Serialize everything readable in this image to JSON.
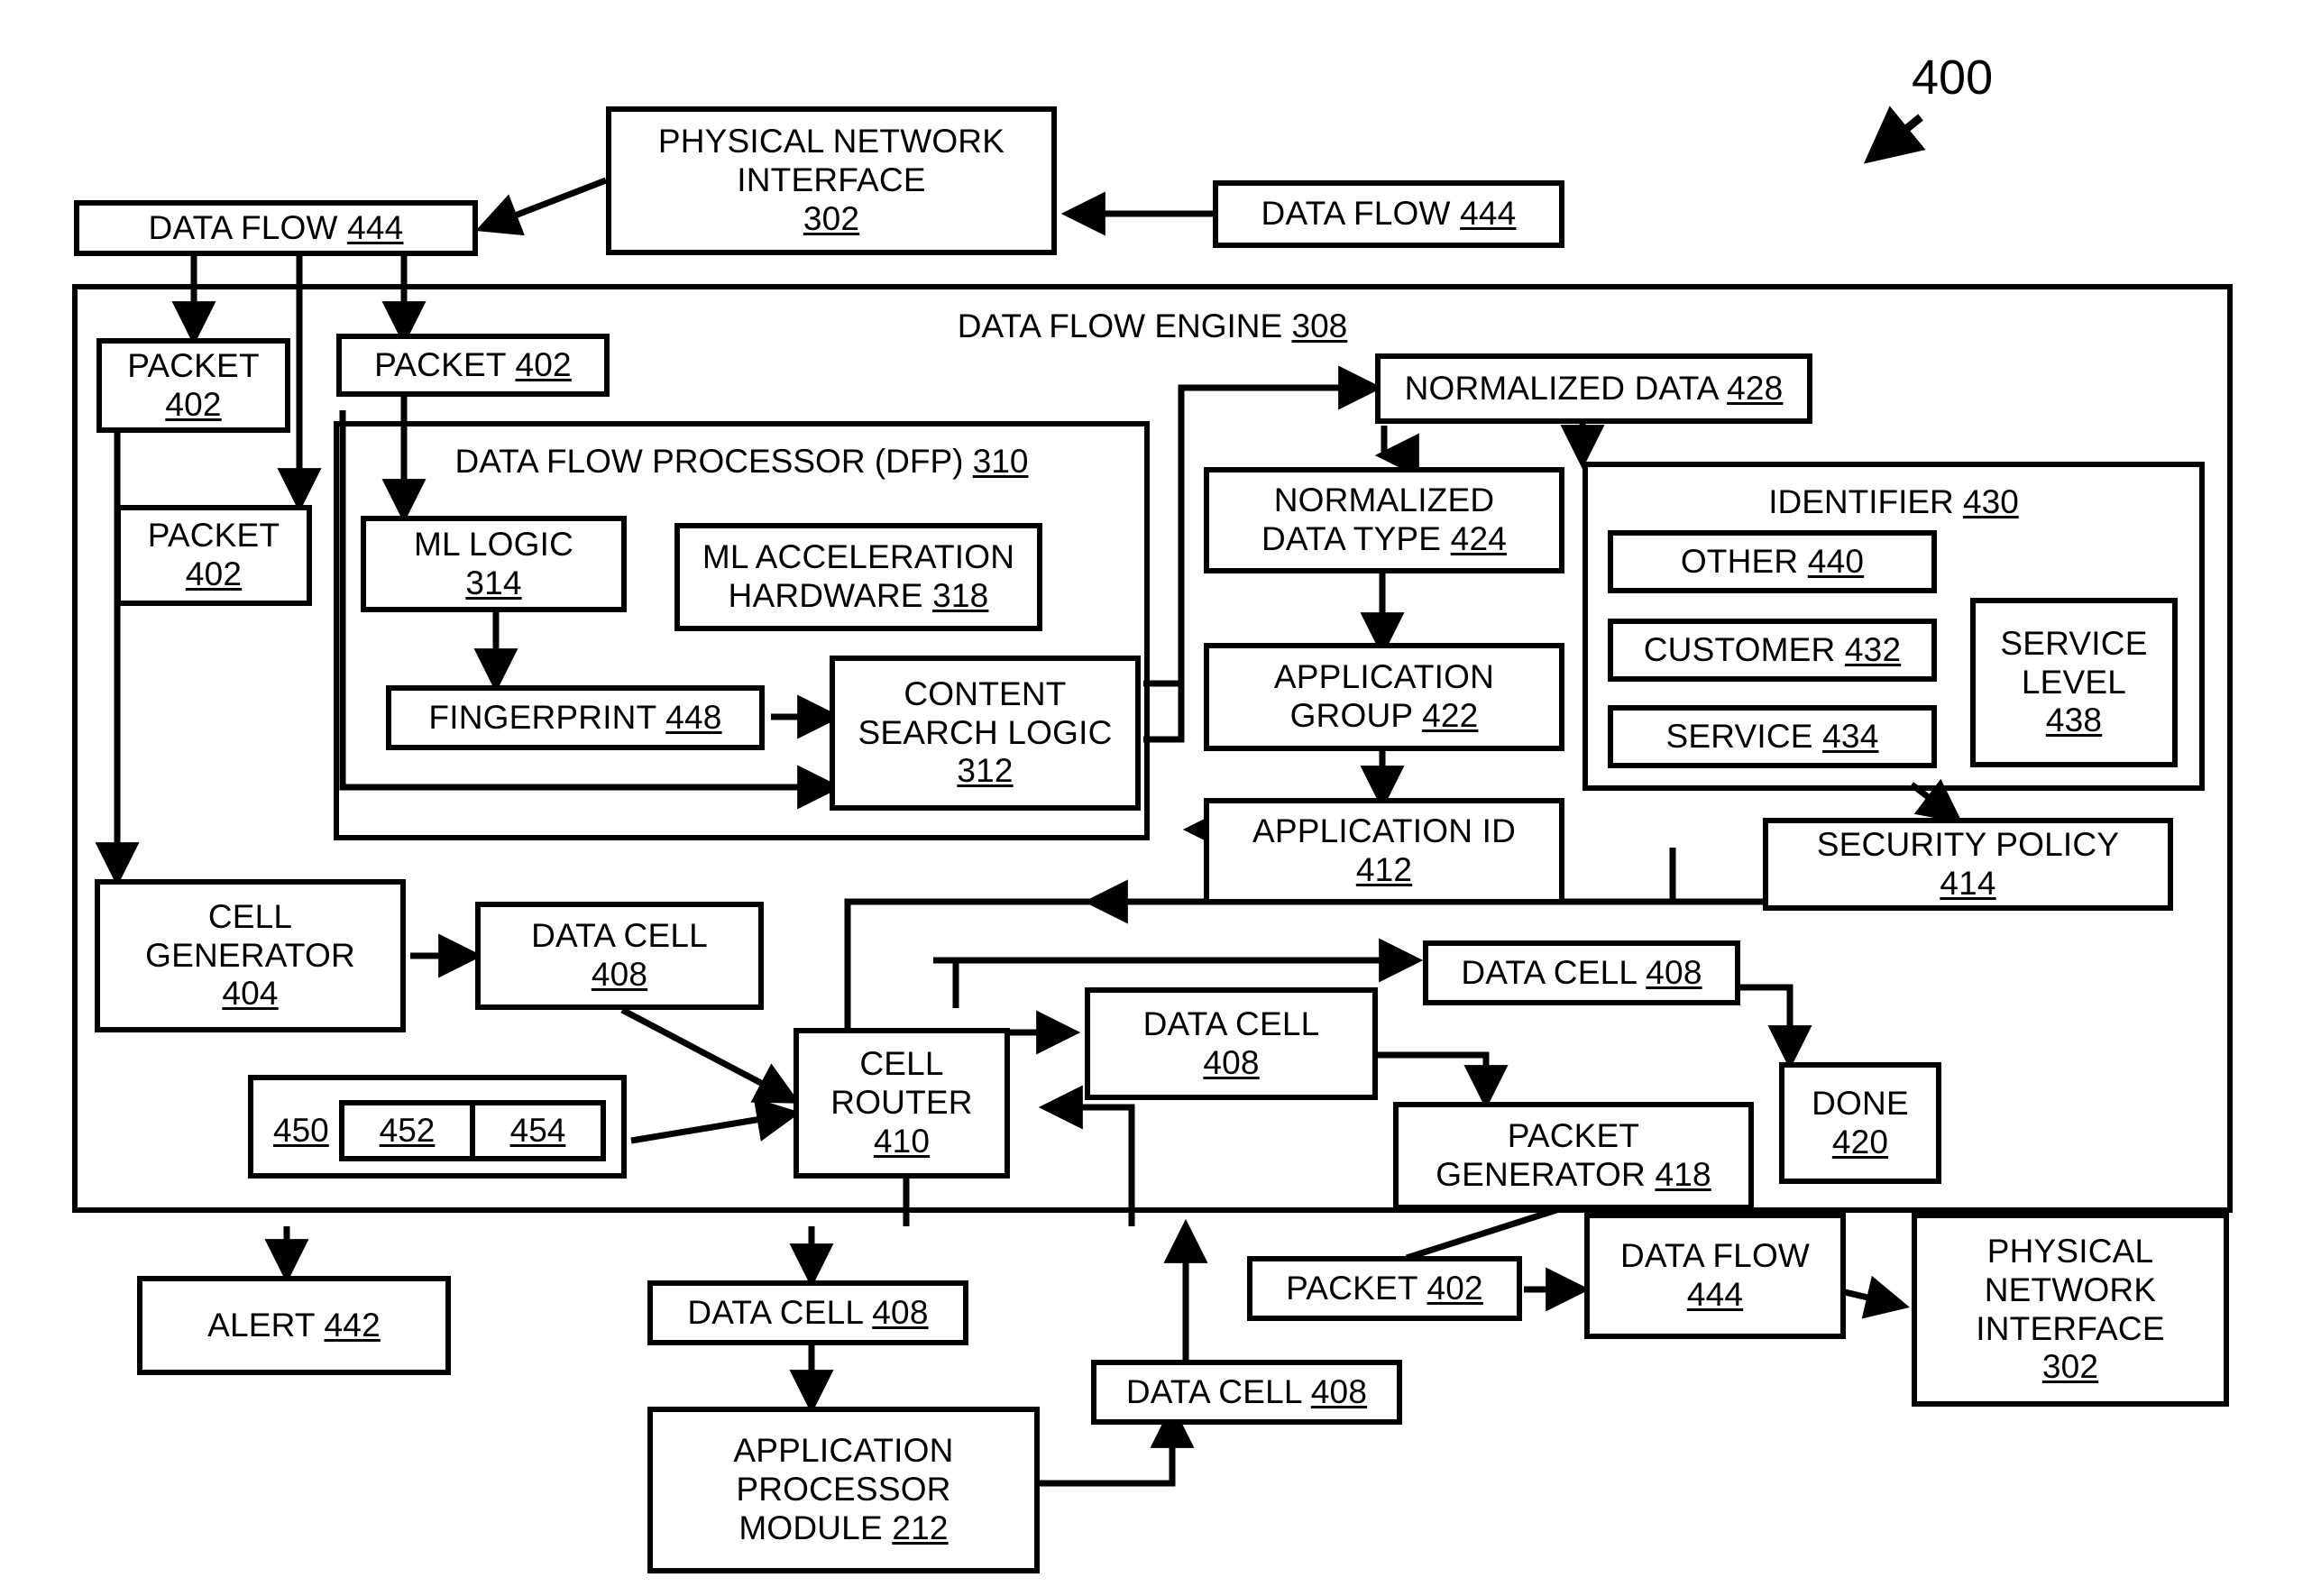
{
  "figure": {
    "number": "400",
    "type": "patent-block-diagram"
  },
  "containers": {
    "data_flow_engine": {
      "title": "DATA FLOW ENGINE ",
      "ref": "308"
    },
    "data_flow_processor": {
      "title": "DATA FLOW PROCESSOR (DFP) ",
      "ref": "310"
    },
    "identifier": {
      "title": "IDENTIFIER ",
      "ref": "430"
    }
  },
  "blocks": {
    "physical_network_interface_top": {
      "line1": "PHYSICAL NETWORK",
      "line2": "INTERFACE",
      "ref": "302"
    },
    "data_flow_right_top": {
      "line1": "DATA FLOW ",
      "ref": "444"
    },
    "data_flow_left_top": {
      "line1": "DATA FLOW ",
      "ref": "444"
    },
    "packet_402_a": {
      "line1": "PACKET",
      "ref": "402"
    },
    "packet_402_b": {
      "line1": "PACKET ",
      "ref": "402"
    },
    "packet_402_c": {
      "line1": "PACKET",
      "ref": "402"
    },
    "ml_logic": {
      "line1": "ML LOGIC",
      "ref": "314"
    },
    "ml_acceleration_hardware": {
      "line1": "ML ACCELERATION",
      "line2": "HARDWARE ",
      "ref": "318"
    },
    "fingerprint": {
      "line1": "FINGERPRINT ",
      "ref": "448"
    },
    "content_search_logic": {
      "line1": "CONTENT",
      "line2": "SEARCH LOGIC",
      "ref": "312"
    },
    "normalized_data": {
      "line1": "NORMALIZED DATA ",
      "ref": "428"
    },
    "normalized_data_type": {
      "line1": "NORMALIZED",
      "line2": "DATA TYPE ",
      "ref": "424"
    },
    "application_group": {
      "line1": "APPLICATION",
      "line2": "GROUP ",
      "ref": "422"
    },
    "application_id": {
      "line1": "APPLICATION ID",
      "ref": "412"
    },
    "security_policy": {
      "line1": "SECURITY POLICY",
      "ref": "414"
    },
    "identifier_other": {
      "line1": "OTHER ",
      "ref": "440"
    },
    "identifier_customer": {
      "line1": "CUSTOMER ",
      "ref": "432"
    },
    "identifier_service": {
      "line1": "SERVICE ",
      "ref": "434"
    },
    "identifier_service_level": {
      "line1": "SERVICE",
      "line2": "LEVEL",
      "ref": "438"
    },
    "cell_generator": {
      "line1": "CELL",
      "line2": "GENERATOR",
      "ref": "404"
    },
    "data_cell_from_generator": {
      "line1": "DATA CELL",
      "ref": "408"
    },
    "cell_router": {
      "line1": "CELL",
      "line2": "ROUTER",
      "ref": "410"
    },
    "data_cell_mid": {
      "line1": "DATA CELL",
      "ref": "408"
    },
    "data_cell_upper_right": {
      "line1": "DATA CELL ",
      "ref": "408"
    },
    "packet_generator": {
      "line1": "PACKET",
      "line2": "GENERATOR ",
      "ref": "418"
    },
    "done": {
      "line1": "DONE",
      "ref": "420"
    },
    "alert": {
      "line1": "ALERT ",
      "ref": "442"
    },
    "data_cell_below_router": {
      "line1": "DATA CELL ",
      "ref": "408"
    },
    "application_processor_module": {
      "line1": "APPLICATION",
      "line2": "PROCESSOR",
      "line3": "MODULE ",
      "ref": "212"
    },
    "data_cell_to_router": {
      "line1": "DATA CELL ",
      "ref": "408"
    },
    "packet_402_out": {
      "line1": "PACKET ",
      "ref": "402"
    },
    "data_flow_out": {
      "line1": "DATA FLOW",
      "ref": "444"
    },
    "physical_network_interface_bottom": {
      "line1": "PHYSICAL",
      "line2": "NETWORK",
      "line3": "INTERFACE",
      "ref": "302"
    }
  },
  "cell_strip": {
    "outer_ref": "450",
    "cells": [
      "452",
      "454"
    ]
  }
}
